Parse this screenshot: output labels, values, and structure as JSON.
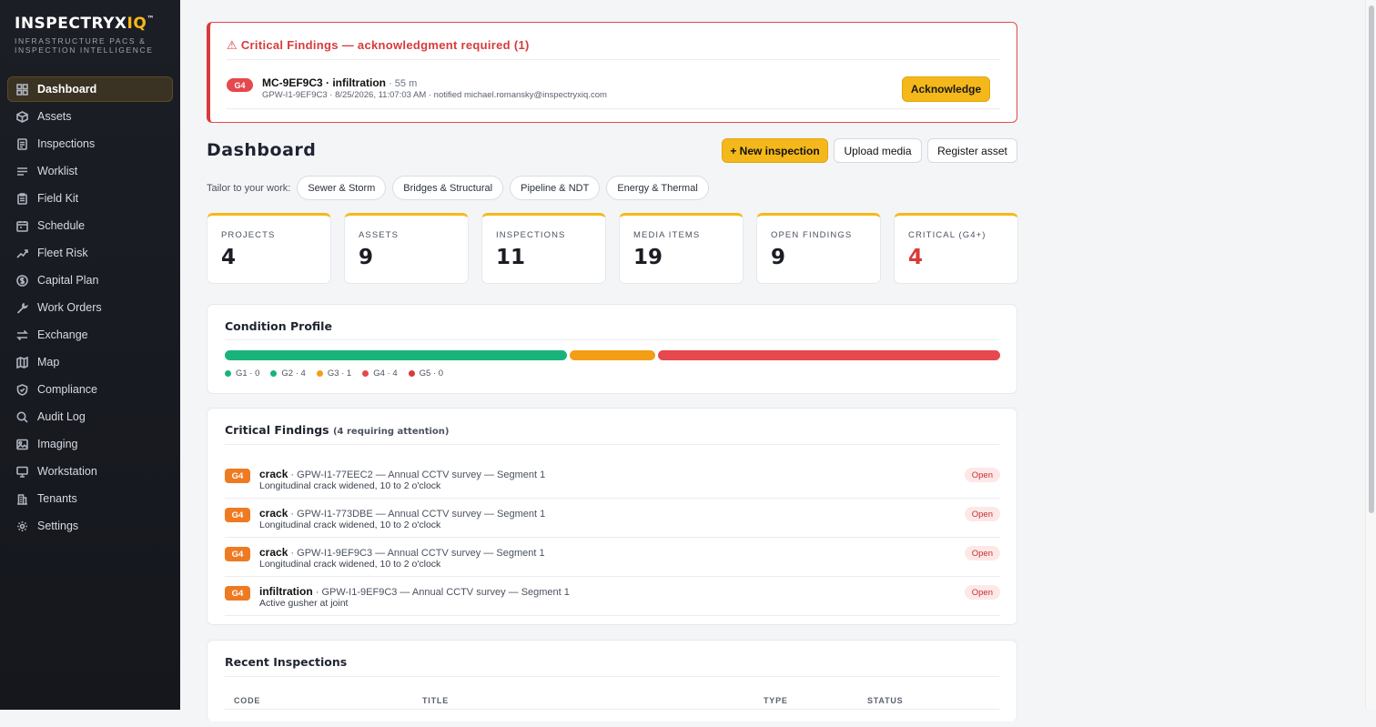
{
  "brand": {
    "name_main": "INSPECTRYX",
    "name_accent": "IQ",
    "name_mark": "™",
    "tagline_line1": "INFRASTRUCTURE PACS &",
    "tagline_line2": "INSPECTION INTELLIGENCE"
  },
  "sidebar": {
    "items": [
      {
        "label": "Dashboard",
        "icon": "grid-icon",
        "active": true
      },
      {
        "label": "Assets",
        "icon": "cube-icon"
      },
      {
        "label": "Inspections",
        "icon": "document-icon"
      },
      {
        "label": "Worklist",
        "icon": "list-icon"
      },
      {
        "label": "Field Kit",
        "icon": "clipboard-icon"
      },
      {
        "label": "Schedule",
        "icon": "calendar-icon"
      },
      {
        "label": "Fleet Risk",
        "icon": "trend-icon"
      },
      {
        "label": "Capital Plan",
        "icon": "dollar-icon"
      },
      {
        "label": "Work Orders",
        "icon": "wrench-icon"
      },
      {
        "label": "Exchange",
        "icon": "swap-icon"
      },
      {
        "label": "Map",
        "icon": "map-icon"
      },
      {
        "label": "Compliance",
        "icon": "shield-icon"
      },
      {
        "label": "Audit Log",
        "icon": "search-icon"
      },
      {
        "label": "Imaging",
        "icon": "image-icon"
      },
      {
        "label": "Workstation",
        "icon": "monitor-icon"
      },
      {
        "label": "Tenants",
        "icon": "building-icon"
      },
      {
        "label": "Settings",
        "icon": "gear-icon"
      }
    ]
  },
  "alert": {
    "title": "⚠ Critical Findings — acknowledgment required (1)",
    "badge": "G4",
    "finding": "MC-9EF9C3 · infiltration",
    "age": " · 55 m",
    "meta": "GPW-I1-9EF9C3 · 8/25/2026, 11:07:03 AM · notified michael.romansky@inspectryxiq.com",
    "button": "Acknowledge"
  },
  "header": {
    "title": "Dashboard",
    "new_inspection": "+ New inspection",
    "upload_media": "Upload media",
    "register_asset": "Register asset"
  },
  "tailor": {
    "label": "Tailor to your work:",
    "chips": [
      "Sewer & Storm",
      "Bridges & Structural",
      "Pipeline & NDT",
      "Energy & Thermal"
    ]
  },
  "stats": [
    {
      "label": "PROJECTS",
      "value": "4"
    },
    {
      "label": "ASSETS",
      "value": "9"
    },
    {
      "label": "INSPECTIONS",
      "value": "11"
    },
    {
      "label": "MEDIA ITEMS",
      "value": "19"
    },
    {
      "label": "OPEN FINDINGS",
      "value": "9"
    },
    {
      "label": "CRITICAL (G4+)",
      "value": "4"
    }
  ],
  "condition": {
    "title": "Condition Profile",
    "grades": [
      {
        "label": "G1 · 0",
        "count": 0,
        "color": "#19b37a"
      },
      {
        "label": "G2 · 4",
        "count": 4,
        "color": "#19b37a"
      },
      {
        "label": "G3 · 1",
        "count": 1,
        "color": "#f29e16"
      },
      {
        "label": "G4 · 4",
        "count": 4,
        "color": "#e5484d"
      },
      {
        "label": "G5 · 0",
        "count": 0,
        "color": "#d93a3a"
      }
    ]
  },
  "critical": {
    "title": "Critical Findings",
    "subtitle": "(4 requiring attention)",
    "items": [
      {
        "grade": "G4",
        "type": "crack",
        "ref": " · GPW-I1-77EEC2 — Annual CCTV survey — Segment 1",
        "desc": "Longitudinal crack widened, 10 to 2 o'clock",
        "status": "Open"
      },
      {
        "grade": "G4",
        "type": "crack",
        "ref": " · GPW-I1-773DBE — Annual CCTV survey — Segment 1",
        "desc": "Longitudinal crack widened, 10 to 2 o'clock",
        "status": "Open"
      },
      {
        "grade": "G4",
        "type": "crack",
        "ref": " · GPW-I1-9EF9C3 — Annual CCTV survey — Segment 1",
        "desc": "Longitudinal crack widened, 10 to 2 o'clock",
        "status": "Open"
      },
      {
        "grade": "G4",
        "type": "infiltration",
        "ref": " · GPW-I1-9EF9C3 — Annual CCTV survey — Segment 1",
        "desc": "Active gusher at joint",
        "status": "Open"
      }
    ]
  },
  "recent": {
    "title": "Recent Inspections",
    "columns": [
      "CODE",
      "TITLE",
      "TYPE",
      "STATUS"
    ]
  },
  "colors": {
    "accent": "#f5b81a",
    "critical": "#d93a3a",
    "grade_g4_badge": "#ee7a22"
  }
}
